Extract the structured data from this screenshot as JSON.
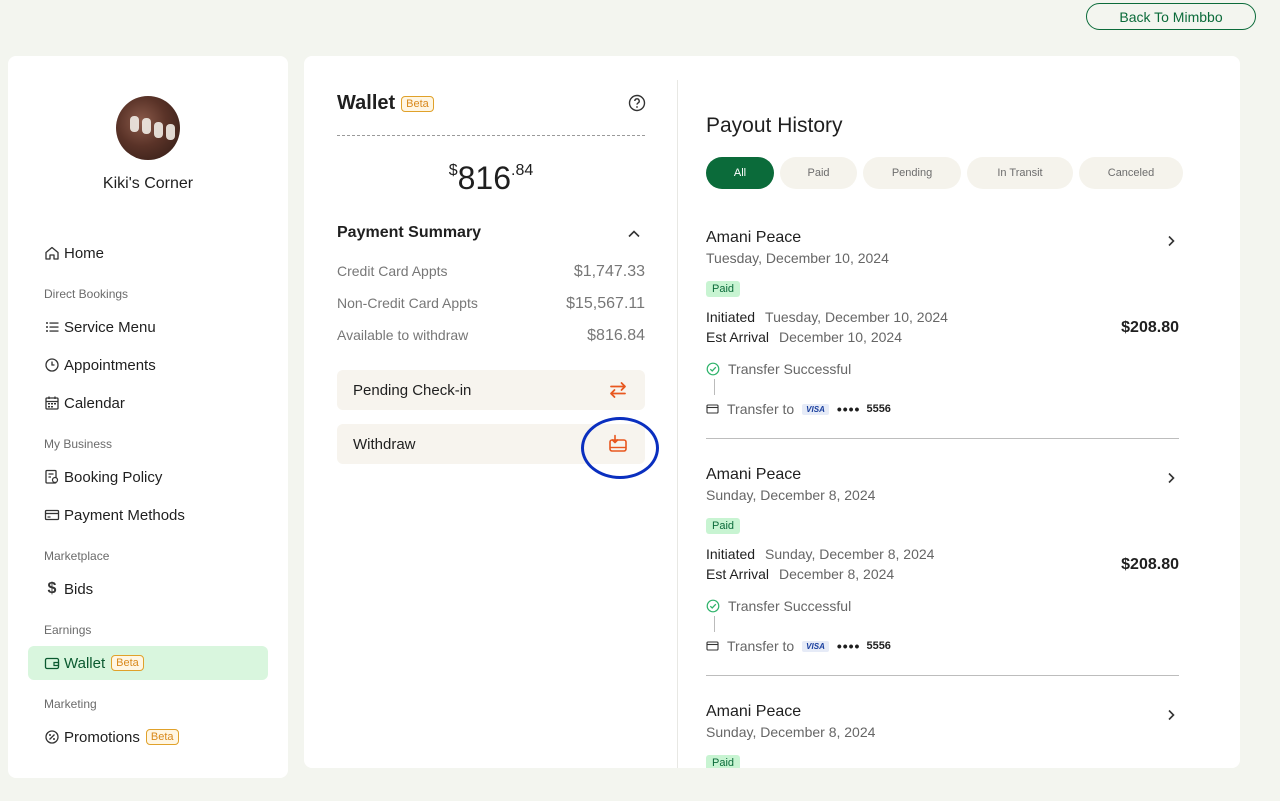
{
  "header": {
    "back_label": "Back To Mimbbo"
  },
  "sidebar": {
    "business_name": "Kiki's Corner",
    "items": [
      {
        "label": "Home",
        "icon": "home-icon"
      },
      {
        "section": "Direct Bookings"
      },
      {
        "label": "Service Menu",
        "icon": "list-icon"
      },
      {
        "label": "Appointments",
        "icon": "clock-icon"
      },
      {
        "label": "Calendar",
        "icon": "calendar-icon"
      },
      {
        "section": "My Business"
      },
      {
        "label": "Booking Policy",
        "icon": "policy-icon"
      },
      {
        "label": "Payment Methods",
        "icon": "credit-card-icon"
      },
      {
        "section": "Marketplace"
      },
      {
        "label": "Bids",
        "icon": "dollar-icon"
      },
      {
        "section": "Earnings"
      },
      {
        "label": "Wallet",
        "icon": "wallet-icon",
        "badge": "Beta",
        "active": true
      },
      {
        "section": "Marketing"
      },
      {
        "label": "Promotions",
        "icon": "promotions-icon",
        "badge": "Beta"
      }
    ]
  },
  "wallet": {
    "title": "Wallet",
    "badge": "Beta",
    "balance": {
      "currency": "$",
      "whole": "816",
      "cents": ".84"
    },
    "summary": {
      "title": "Payment Summary",
      "rows": [
        {
          "label": "Credit Card Appts",
          "value": "$1,747.33"
        },
        {
          "label": "Non-Credit Card Appts",
          "value": "$15,567.11"
        },
        {
          "label": "Available to withdraw",
          "value": "$816.84"
        }
      ]
    },
    "actions": [
      {
        "label": "Pending Check-in",
        "icon": "transfer-arrows-icon"
      },
      {
        "label": "Withdraw",
        "icon": "withdraw-icon"
      }
    ]
  },
  "payout_history": {
    "title": "Payout History",
    "filters": [
      "All",
      "Paid",
      "Pending",
      "In Transit",
      "Canceled"
    ],
    "active_filter": "All",
    "items": [
      {
        "name": "Amani Peace",
        "date": "Tuesday, December 10, 2024",
        "status": "Paid",
        "initiated_label": "Initiated",
        "initiated": "Tuesday, December 10, 2024",
        "arrival_label": "Est Arrival",
        "arrival": "December 10, 2024",
        "amount": "$208.80",
        "transfer_status": "Transfer Successful",
        "transfer_to": "Transfer to",
        "card_brand": "VISA",
        "card_dots": "••••",
        "card_last4": "5556"
      },
      {
        "name": "Amani Peace",
        "date": "Sunday, December 8, 2024",
        "status": "Paid",
        "initiated_label": "Initiated",
        "initiated": "Sunday, December 8, 2024",
        "arrival_label": "Est Arrival",
        "arrival": "December 8, 2024",
        "amount": "$208.80",
        "transfer_status": "Transfer Successful",
        "transfer_to": "Transfer to",
        "card_brand": "VISA",
        "card_dots": "••••",
        "card_last4": "5556"
      },
      {
        "name": "Amani Peace",
        "date": "Sunday, December 8, 2024",
        "status": "Paid"
      }
    ]
  },
  "colors": {
    "brand": "#0b6b3a",
    "accent_orange": "#e8571f",
    "active_bg": "#d9f6de",
    "highlight": "#0a2fbf"
  }
}
